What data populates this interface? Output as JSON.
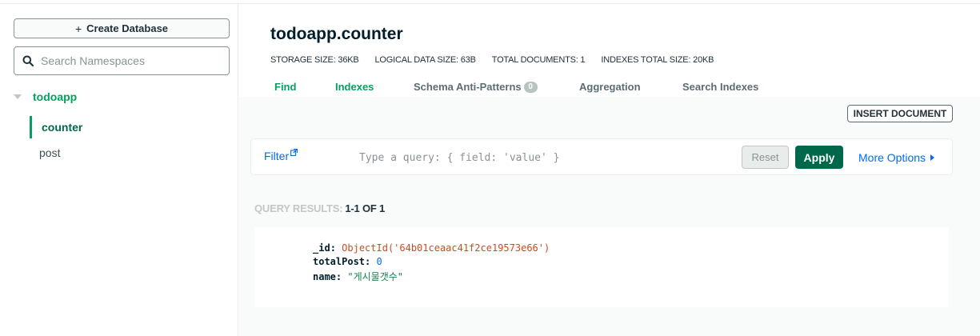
{
  "sidebar": {
    "create_database_label": "Create Database",
    "search_placeholder": "Search Namespaces",
    "database": "todoapp",
    "collections": [
      {
        "name": "counter",
        "active": true
      },
      {
        "name": "post",
        "active": false
      }
    ]
  },
  "collection": {
    "title": "todoapp.counter",
    "stats": {
      "storage_size": "STORAGE SIZE: 36KB",
      "logical_size": "LOGICAL DATA SIZE: 63B",
      "total_documents": "TOTAL DOCUMENTS: 1",
      "indexes_size": "INDEXES TOTAL SIZE: 20KB"
    }
  },
  "tabs": [
    {
      "label": "Find",
      "active": true
    },
    {
      "label": "Indexes",
      "active": true
    },
    {
      "label": "Schema Anti-Patterns",
      "badge": "0"
    },
    {
      "label": "Aggregation"
    },
    {
      "label": "Search Indexes"
    }
  ],
  "toolbar": {
    "insert_label": "INSERT DOCUMENT"
  },
  "filter": {
    "label": "Filter",
    "placeholder": "Type a query: { field: 'value' }",
    "reset_label": "Reset",
    "apply_label": "Apply",
    "more_options_label": "More Options"
  },
  "results": {
    "label": "QUERY RESULTS:",
    "count": "1-1 OF 1"
  },
  "document": {
    "fields": [
      {
        "key": "_id",
        "value": "ObjectId('64b01ceaac41f2ce19573e66')",
        "type": "oid"
      },
      {
        "key": "totalPost",
        "value": "0",
        "type": "num"
      },
      {
        "key": "name",
        "value": "\"게시물갯수\"",
        "type": "str"
      }
    ]
  },
  "colors": {
    "accent_green": "#00a35c",
    "dark_green": "#00684a",
    "link_blue": "#016bf8"
  }
}
